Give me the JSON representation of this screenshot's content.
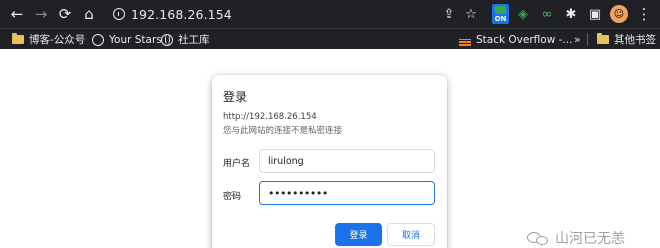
{
  "browser": {
    "url": "192.168.26.154",
    "ext_on_label": "ON"
  },
  "bookmarks": {
    "items": [
      {
        "label": "博客-公众号",
        "icon": "folder-icon"
      },
      {
        "label": "Your Stars",
        "icon": "github-icon"
      },
      {
        "label": "社工库",
        "icon": "globe-icon"
      },
      {
        "label": "Stack Overflow -...",
        "icon": "stack-overflow-icon"
      },
      {
        "label": "其他书签",
        "icon": "folder-icon"
      }
    ],
    "more": "»"
  },
  "dialog": {
    "title": "登录",
    "url": "http://192.168.26.154",
    "warning": "您与此网站的连接不是私密连接",
    "username_label": "用户名",
    "username_value": "lirulong",
    "password_label": "密码",
    "password_value": "••••••••••",
    "login_label": "登录",
    "cancel_label": "取消"
  },
  "watermark": {
    "text": "山河已无恙"
  },
  "colors": {
    "toolbar_bg": "#202124",
    "accent": "#1a73e8",
    "folder": "#e8c15a",
    "stack_overflow": "#f48024"
  }
}
